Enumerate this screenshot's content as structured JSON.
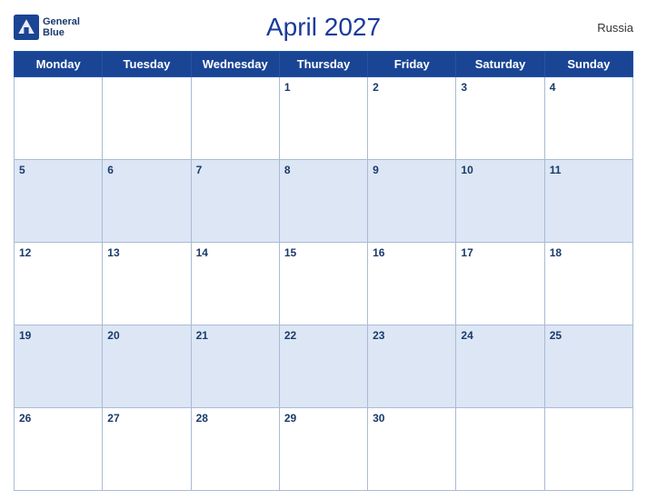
{
  "header": {
    "title": "April 2027",
    "country": "Russia",
    "logo_line1": "General",
    "logo_line2": "Blue"
  },
  "weekdays": [
    "Monday",
    "Tuesday",
    "Wednesday",
    "Thursday",
    "Friday",
    "Saturday",
    "Sunday"
  ],
  "weeks": [
    [
      null,
      null,
      null,
      1,
      2,
      3,
      4
    ],
    [
      5,
      6,
      7,
      8,
      9,
      10,
      11
    ],
    [
      12,
      13,
      14,
      15,
      16,
      17,
      18
    ],
    [
      19,
      20,
      21,
      22,
      23,
      24,
      25
    ],
    [
      26,
      27,
      28,
      29,
      30,
      null,
      null
    ]
  ]
}
